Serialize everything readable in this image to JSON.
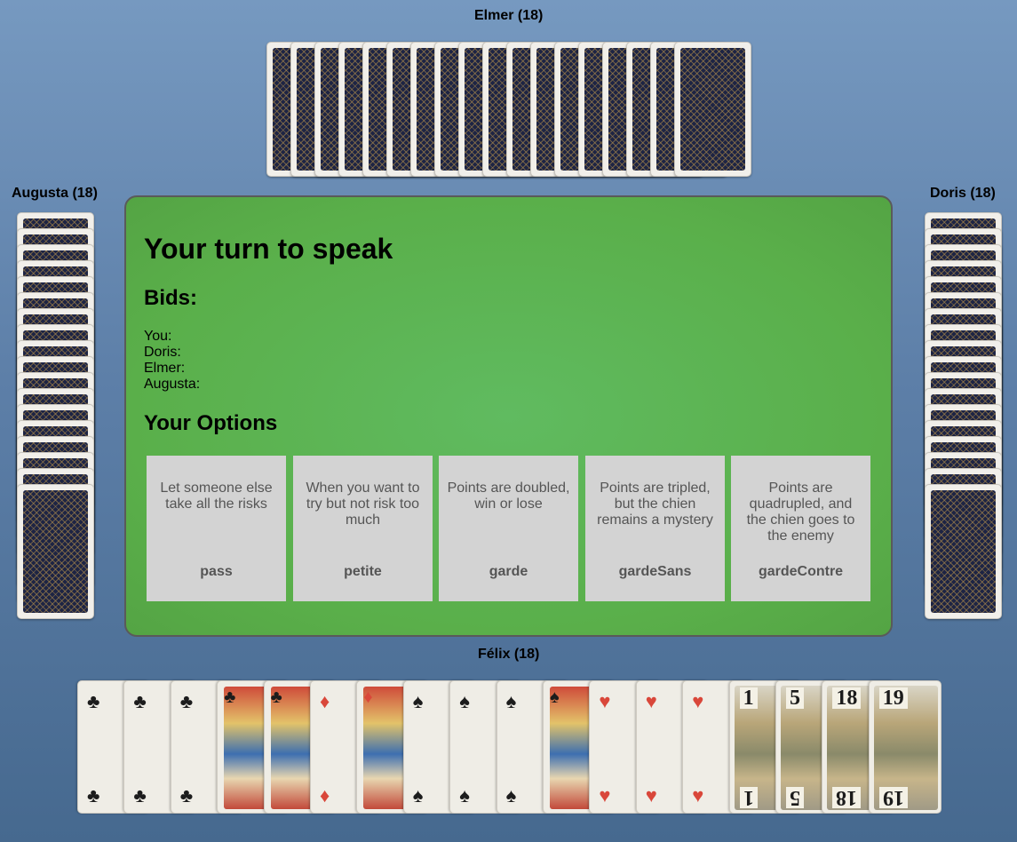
{
  "players": {
    "north": {
      "label": "Elmer (18)"
    },
    "west": {
      "label": "Augusta (18)"
    },
    "east": {
      "label": "Doris (18)"
    },
    "south": {
      "label": "Félix (18)"
    }
  },
  "table": {
    "title": "Your turn to speak",
    "bids_heading": "Bids:",
    "bids": [
      "You:",
      "Doris:",
      "Elmer:",
      "Augusta:"
    ],
    "options_heading": "Your Options",
    "options": [
      {
        "description": "Let someone else take all the risks",
        "name": "pass"
      },
      {
        "description": "When you want to try but not risk too much",
        "name": "petite"
      },
      {
        "description": "Points are doubled, win or lose",
        "name": "garde"
      },
      {
        "description": "Points are tripled, but the chien remains a mystery",
        "name": "gardeSans"
      },
      {
        "description": "Points are quadrupled, and the chien goes to the enemy",
        "name": "gardeContre"
      }
    ]
  },
  "hand": {
    "cards": [
      {
        "kind": "pip",
        "suit": "clubs",
        "symbol": "♣",
        "color": "black"
      },
      {
        "kind": "pip",
        "suit": "clubs",
        "symbol": "♣",
        "color": "black"
      },
      {
        "kind": "pip",
        "suit": "clubs",
        "symbol": "♣",
        "color": "black"
      },
      {
        "kind": "court",
        "suit": "clubs",
        "symbol": "♣",
        "color": "black"
      },
      {
        "kind": "court",
        "suit": "clubs",
        "symbol": "♣",
        "color": "black"
      },
      {
        "kind": "pip",
        "suit": "diamonds",
        "symbol": "♦",
        "color": "red"
      },
      {
        "kind": "court",
        "suit": "diamonds",
        "symbol": "♦",
        "color": "red"
      },
      {
        "kind": "pip",
        "suit": "spades",
        "symbol": "♠",
        "color": "black"
      },
      {
        "kind": "pip",
        "suit": "spades",
        "symbol": "♠",
        "color": "black"
      },
      {
        "kind": "pip",
        "suit": "spades",
        "symbol": "♠",
        "color": "black"
      },
      {
        "kind": "court",
        "suit": "spades",
        "symbol": "♠",
        "color": "black"
      },
      {
        "kind": "pip",
        "suit": "hearts",
        "symbol": "♥",
        "color": "red"
      },
      {
        "kind": "pip",
        "suit": "hearts",
        "symbol": "♥",
        "color": "red"
      },
      {
        "kind": "pip",
        "suit": "hearts",
        "symbol": "♥",
        "color": "red"
      },
      {
        "kind": "trump",
        "number": "1"
      },
      {
        "kind": "trump",
        "number": "5"
      },
      {
        "kind": "trump",
        "number": "18"
      },
      {
        "kind": "trump",
        "number": "19"
      }
    ]
  },
  "colors": {
    "table_felt": "#5db55a",
    "option_bg": "#d3d3d3",
    "card_back": "#1d2444"
  }
}
